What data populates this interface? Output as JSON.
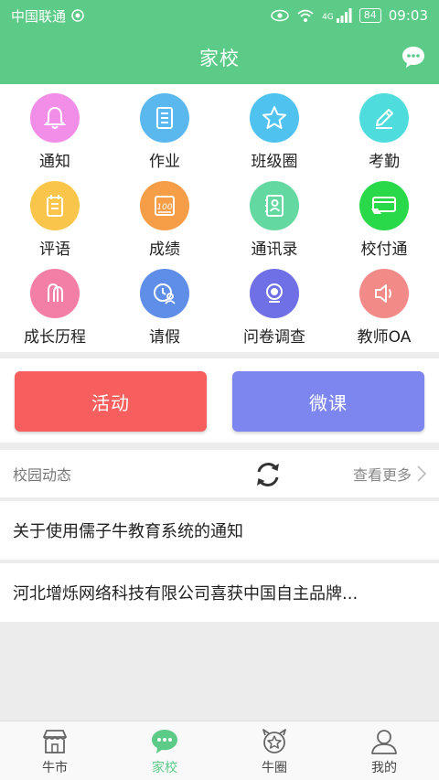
{
  "status": {
    "carrier": "中国联通",
    "network": "4G",
    "battery": "84",
    "time": "09:03"
  },
  "header": {
    "title": "家校"
  },
  "grid": [
    {
      "label": "通知",
      "icon": "bell-icon",
      "color": "#f38ee8"
    },
    {
      "label": "作业",
      "icon": "homework-icon",
      "color": "#5ab8ef"
    },
    {
      "label": "班级圈",
      "icon": "star-icon",
      "color": "#4fc2f0"
    },
    {
      "label": "考勤",
      "icon": "pencil-icon",
      "color": "#4fdcdc"
    },
    {
      "label": "评语",
      "icon": "notepad-icon",
      "color": "#f9c64b"
    },
    {
      "label": "成绩",
      "icon": "score-icon",
      "color": "#f59d47"
    },
    {
      "label": "通讯录",
      "icon": "contacts-icon",
      "color": "#63d8a0"
    },
    {
      "label": "校付通",
      "icon": "card-icon",
      "color": "#29d94a"
    },
    {
      "label": "成长历程",
      "icon": "people-icon",
      "color": "#f37ea6"
    },
    {
      "label": "请假",
      "icon": "leave-icon",
      "color": "#5f8ee9"
    },
    {
      "label": "问卷调查",
      "icon": "survey-icon",
      "color": "#6f6fe6"
    },
    {
      "label": "教师OA",
      "icon": "speaker-icon",
      "color": "#f28a87"
    }
  ],
  "actions": {
    "activity": "活动",
    "course": "微课"
  },
  "news": {
    "title": "校园动态",
    "more": "查看更多",
    "items": [
      "关于使用儒子牛教育系统的通知",
      "河北增烁网络科技有限公司喜获中国自主品牌..."
    ]
  },
  "tabs": [
    {
      "label": "牛市",
      "icon": "shop-icon"
    },
    {
      "label": "家校",
      "icon": "chat-bubble-icon"
    },
    {
      "label": "牛圈",
      "icon": "bull-circle-icon"
    },
    {
      "label": "我的",
      "icon": "user-icon"
    }
  ],
  "colors": {
    "primary": "#5ccb87",
    "activity": "#f65f5d",
    "course": "#7d86ef"
  }
}
